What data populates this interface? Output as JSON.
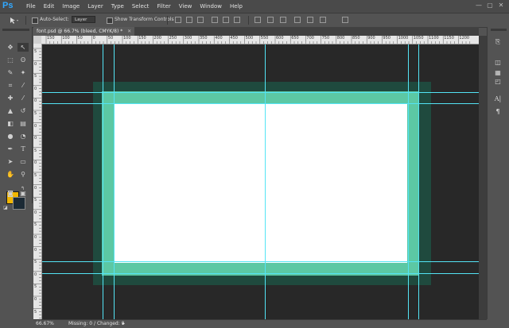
{
  "app": {
    "logo": "Ps"
  },
  "menubar": {
    "items": [
      "File",
      "Edit",
      "Image",
      "Layer",
      "Type",
      "Select",
      "Filter",
      "View",
      "Window",
      "Help"
    ],
    "window_controls": [
      "—",
      "▢",
      "✕"
    ]
  },
  "options": {
    "auto_select_label": "Auto-Select:",
    "auto_select_value": "Layer",
    "transform_label": "Show Transform Controls"
  },
  "document": {
    "tab_title": "font.psd @ 66.7% (bleed, CMYK/8) *"
  },
  "ruler_h": {
    "ticks": [
      "150",
      "100",
      "50",
      "0",
      "50",
      "100",
      "150",
      "200",
      "250",
      "300",
      "350",
      "400",
      "450",
      "500",
      "550",
      "600",
      "650",
      "700",
      "750",
      "800",
      "850",
      "900",
      "950",
      "1000",
      "1050",
      "1100",
      "1150",
      "1200"
    ]
  },
  "ruler_v": {
    "ticks": [
      "5",
      "0",
      "5",
      "0",
      "0",
      "5",
      "0",
      "0",
      "5",
      "0",
      "5",
      "0",
      "5",
      "0",
      "5",
      "0",
      "0",
      "5",
      "0",
      "5",
      "0",
      "5"
    ]
  },
  "status": {
    "zoom": "66.67%",
    "info": "Missing: 0 / Changed: 0"
  },
  "colors": {
    "foreground": "#f2b600",
    "background": "#1c2a35",
    "bleed": "#1f4a3e",
    "trim": "#5cc8a4",
    "guide": "#53e4f5"
  },
  "icons": {
    "tools": [
      "move-icon",
      "marquee-icon",
      "lasso-icon",
      "magic-wand-icon",
      "crop-icon",
      "eyedropper-icon",
      "healing-icon",
      "brush-icon",
      "stamp-icon",
      "history-brush-icon",
      "eraser-icon",
      "gradient-icon",
      "blur-icon",
      "dodge-icon",
      "pen-icon",
      "type-icon",
      "path-select-icon",
      "shape-icon",
      "hand-icon",
      "zoom-icon"
    ],
    "right": [
      "history-icon",
      "layers-icon",
      "channels-icon",
      "paths-icon",
      "character-icon",
      "paragraph-icon"
    ]
  }
}
